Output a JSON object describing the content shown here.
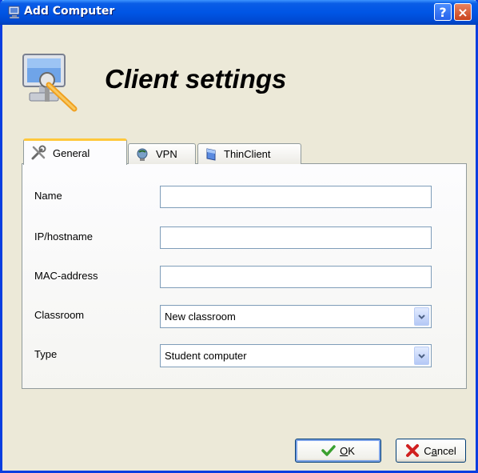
{
  "window": {
    "title": "Add Computer",
    "help_label": "?",
    "close_label": "×",
    "titlebar_color": "#0055e5"
  },
  "header": {
    "title": "Client settings",
    "icon": "computer-wrench-icon"
  },
  "tabs": [
    {
      "label": "General",
      "icon": "tools-icon",
      "active": true
    },
    {
      "label": "VPN",
      "icon": "vpn-globe-icon",
      "active": false
    },
    {
      "label": "ThinClient",
      "icon": "thinclient-icon",
      "active": false
    }
  ],
  "form": {
    "name_label": "Name",
    "name_value": "",
    "ip_label": "IP/hostname",
    "ip_value": "",
    "mac_label": "MAC-address",
    "mac_value": "",
    "classroom_label": "Classroom",
    "classroom_value": "New classroom",
    "type_label": "Type",
    "type_value": "Student computer"
  },
  "buttons": {
    "ok_hotkey": "O",
    "ok_rest": "K",
    "cancel_prefix": "C",
    "cancel_hotkey": "a",
    "cancel_rest": "ncel"
  }
}
